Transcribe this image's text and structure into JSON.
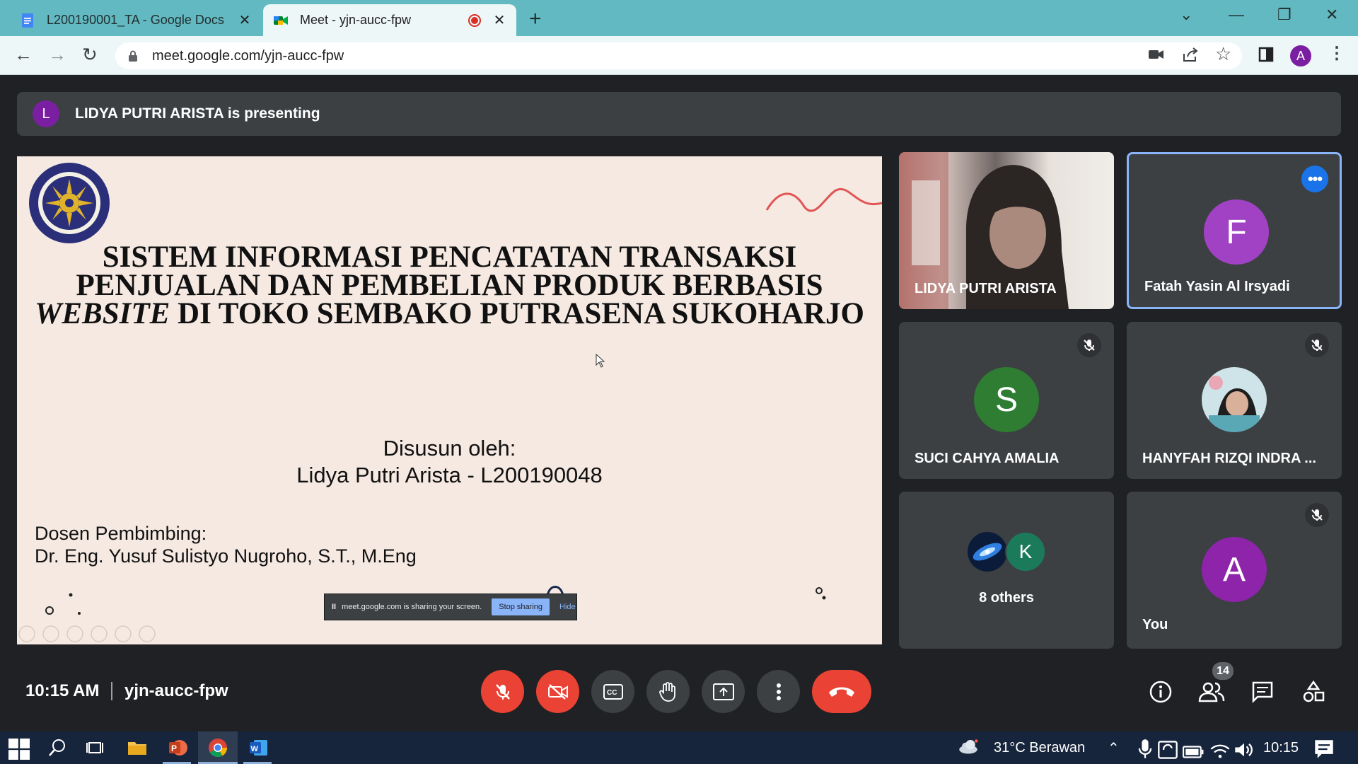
{
  "browser": {
    "tabs": [
      {
        "title": "L200190001_TA - Google Docs",
        "active": false
      },
      {
        "title": "Meet - yjn-aucc-fpw",
        "active": true
      }
    ],
    "url": "meet.google.com/yjn-aucc-fpw",
    "profile_initial": "A"
  },
  "meet": {
    "presenter_initial": "L",
    "presenting_banner": "LIDYA PUTRI ARISTA is presenting",
    "slide": {
      "title_line1": "SISTEM INFORMASI PENCATATAN TRANSAKSI",
      "title_line2": "PENJUALAN DAN PEMBELIAN PRODUK BERBASIS",
      "title_line3_italic": "WEBSITE",
      "title_line3_rest": " DI TOKO SEMBAKO PUTRASENA SUKOHARJO",
      "author_label": "Disusun oleh:",
      "author_name": "Lidya Putri Arista - L200190048",
      "advisor_label": "Dosen Pembimbing:",
      "advisor_name": "Dr. Eng. Yusuf Sulistyo Nugroho, S.T., M.Eng"
    },
    "share_notice": {
      "pause_glyph": "II",
      "text": "meet.google.com is sharing your screen.",
      "stop_label": "Stop sharing",
      "hide_label": "Hide"
    },
    "participants": [
      {
        "name": "LIDYA PUTRI ARISTA",
        "video": true
      },
      {
        "name": "Fatah Yasin Al Irsyadi",
        "initial": "F",
        "color": "#a142c4",
        "muted": false
      },
      {
        "name": "SUCI CAHYA AMALIA",
        "initial": "S",
        "color": "#2e7d32",
        "muted": true
      },
      {
        "name": "HANYFAH RIZQI INDRA ...",
        "muted": true,
        "photo": true
      },
      {
        "others_label": "8 others",
        "others_initial": "K",
        "others_color": "#1b7a5a"
      },
      {
        "name": "You",
        "initial": "A",
        "color": "#8e24aa",
        "muted": true
      }
    ],
    "time": "10:15 AM",
    "meeting_code": "yjn-aucc-fpw",
    "people_count": "14"
  },
  "taskbar": {
    "weather": "31°C  Berawan",
    "clock": "10:15"
  }
}
